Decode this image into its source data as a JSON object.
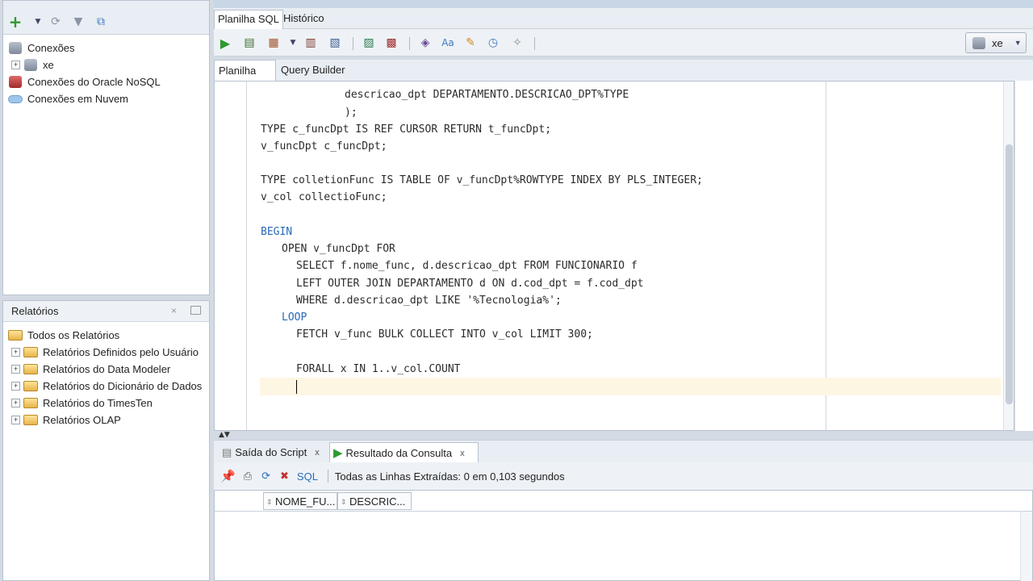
{
  "connections_panel": {
    "items": [
      {
        "label": "Conexões"
      },
      {
        "label": "xe"
      },
      {
        "label": "Conexões do Oracle NoSQL"
      },
      {
        "label": "Conexões em Nuvem"
      }
    ]
  },
  "reports_panel": {
    "title": "Relatórios",
    "items": [
      {
        "label": "Todos os Relatórios"
      },
      {
        "label": "Relatórios Definidos pelo Usuário"
      },
      {
        "label": "Relatórios do Data Modeler"
      },
      {
        "label": "Relatórios do Dicionário de Dados"
      },
      {
        "label": "Relatórios do TimesTen"
      },
      {
        "label": "Relatórios OLAP"
      }
    ]
  },
  "editor": {
    "tabs": [
      "Planilha SQL",
      "Histórico"
    ],
    "worksheet_tabs": [
      "Planilha",
      "Query Builder"
    ],
    "connection": "xe"
  },
  "code": {
    "lines": [
      "descricao_dpt DEPARTAMENTO.DESCRICAO_DPT%TYPE",
      ");",
      "TYPE c_funcDpt IS REF CURSOR RETURN t_funcDpt;",
      "v_funcDpt c_funcDpt;",
      "TYPE colletionFunc IS TABLE OF v_funcDpt%ROWTYPE INDEX BY PLS_INTEGER;",
      "v_col collectioFunc;",
      "BEGIN",
      "OPEN v_funcDpt FOR",
      "SELECT f.nome_func, d.descricao_dpt FROM FUNCIONARIO f",
      "LEFT OUTER JOIN DEPARTAMENTO d ON d.cod_dpt = f.cod_dpt",
      "WHERE d.descricao_dpt LIKE '%Tecnologia%';",
      "LOOP",
      "FETCH v_func BULK COLLECT INTO v_col LIMIT 300;",
      "FORALL x IN 1..v_col.COUNT"
    ]
  },
  "results": {
    "tabs": [
      {
        "label": "Saída do Script",
        "close": "x"
      },
      {
        "label": "Resultado da Consulta",
        "close": "x"
      }
    ],
    "sql_link": "SQL",
    "status": "Todas as Linhas Extraídas: 0 em 0,103 segundos",
    "columns": [
      "NOME_FU...",
      "DESCRIC..."
    ]
  },
  "colors": {
    "keyword": "#2a6ab8",
    "number": "#2b7a2b",
    "current_line": "#fdf6e3"
  }
}
